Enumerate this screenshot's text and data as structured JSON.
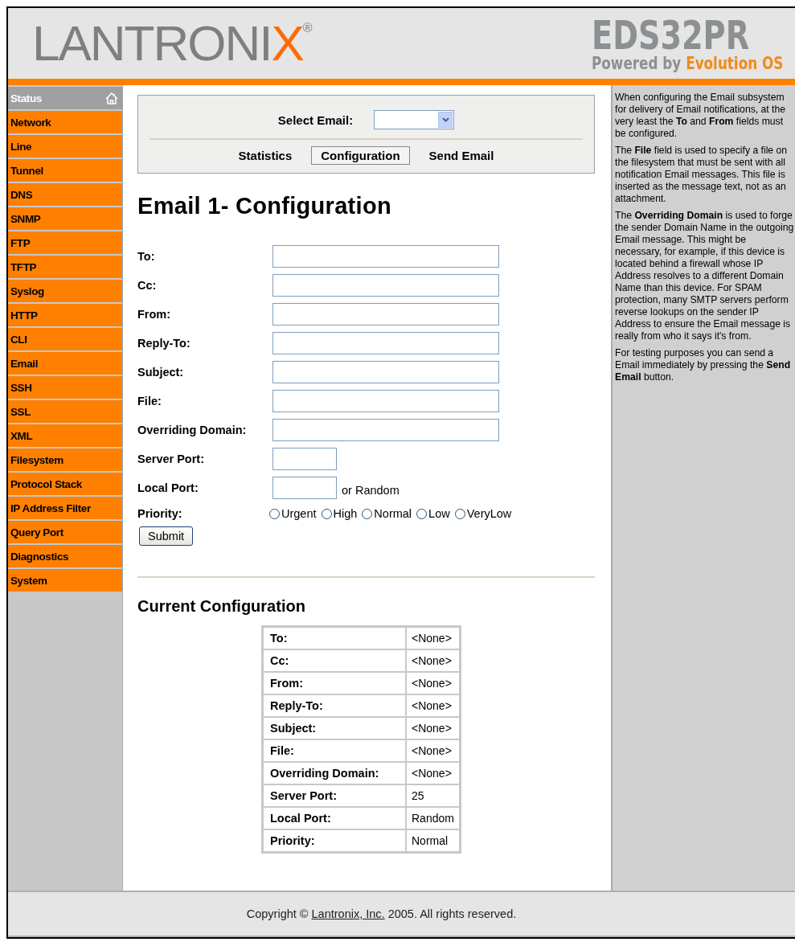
{
  "header": {
    "logo": {
      "text": "LANTRONI",
      "accent": "X",
      "mark": "®"
    },
    "product": "EDS32PR",
    "tagline": "Powered by ",
    "tagline_accent": "Evolution OS"
  },
  "sidebar": {
    "items": [
      {
        "label": "Status",
        "selected": true
      },
      {
        "label": "Network",
        "selected": false
      },
      {
        "label": "Line",
        "selected": false
      },
      {
        "label": "Tunnel",
        "selected": false
      },
      {
        "label": "DNS",
        "selected": false
      },
      {
        "label": "SNMP",
        "selected": false
      },
      {
        "label": "FTP",
        "selected": false
      },
      {
        "label": "TFTP",
        "selected": false
      },
      {
        "label": "Syslog",
        "selected": false
      },
      {
        "label": "HTTP",
        "selected": false
      },
      {
        "label": "CLI",
        "selected": false
      },
      {
        "label": "Email",
        "selected": false
      },
      {
        "label": "SSH",
        "selected": false
      },
      {
        "label": "SSL",
        "selected": false
      },
      {
        "label": "XML",
        "selected": false
      },
      {
        "label": "Filesystem",
        "selected": false
      },
      {
        "label": "Protocol Stack",
        "selected": false
      },
      {
        "label": "IP Address Filter",
        "selected": false
      },
      {
        "label": "Query Port",
        "selected": false
      },
      {
        "label": "Diagnostics",
        "selected": false
      },
      {
        "label": "System",
        "selected": false
      }
    ]
  },
  "selector": {
    "label": "Select Email:",
    "tabs": [
      {
        "label": "Statistics",
        "selected": false
      },
      {
        "label": "Configuration",
        "selected": true
      },
      {
        "label": "Send Email",
        "selected": false
      }
    ]
  },
  "form": {
    "title": "Email 1- Configuration",
    "fields": [
      {
        "label": "To:",
        "kind": "wide"
      },
      {
        "label": "Cc:",
        "kind": "wide"
      },
      {
        "label": "From:",
        "kind": "wide"
      },
      {
        "label": "Reply-To:",
        "kind": "wide"
      },
      {
        "label": "Subject:",
        "kind": "wide"
      },
      {
        "label": "File:",
        "kind": "wide"
      },
      {
        "label": "Overriding Domain:",
        "kind": "wide"
      },
      {
        "label": "Server Port:",
        "kind": "narrow"
      },
      {
        "label": "Local Port:",
        "kind": "narrow",
        "suffix": "or Random"
      }
    ],
    "priority": {
      "label": "Priority:",
      "options": [
        {
          "label": "Urgent",
          "selected": false
        },
        {
          "label": "High",
          "selected": false
        },
        {
          "label": "Normal",
          "selected": false
        },
        {
          "label": "Low",
          "selected": false
        },
        {
          "label": "VeryLow",
          "selected": false
        }
      ]
    },
    "submit": "Submit"
  },
  "current": {
    "title": "Current Configuration",
    "rows": [
      {
        "name": "To:",
        "value": "<None>"
      },
      {
        "name": "Cc:",
        "value": "<None>"
      },
      {
        "name": "From:",
        "value": "<None>"
      },
      {
        "name": "Reply-To:",
        "value": "<None>"
      },
      {
        "name": "Subject:",
        "value": "<None>"
      },
      {
        "name": "File:",
        "value": "<None>"
      },
      {
        "name": "Overriding Domain:",
        "value": "<None>"
      },
      {
        "name": "Server Port:",
        "value": "25"
      },
      {
        "name": "Local Port:",
        "value": "Random"
      },
      {
        "name": "Priority:",
        "value": "Normal"
      }
    ]
  },
  "help": [
    "When configuring the Email subsystem for delivery of Email notifications, at the very least the **To** and **From** fields must be configured.",
    "The **File** field is used to specify a file on the filesystem that must be sent with all notification Email messages. This file is inserted as the message text, not as an attachment.",
    "The **Overriding Domain** is used to forge the sender Domain Name in the outgoing Email message. This might be necessary, for example, if this device is located behind a firewall whose IP Address resolves to a different Domain Name than this device. For SPAM protection, many SMTP servers perform reverse lookups on the sender IP Address to ensure the Email message is really from who it says it's from.",
    "For testing purposes you can send a Email immediately by pressing the **Send Email** button."
  ],
  "footer": {
    "before": "Copyright © ",
    "link": "Lantronix, Inc.",
    "after": " 2005. All rights reserved."
  }
}
